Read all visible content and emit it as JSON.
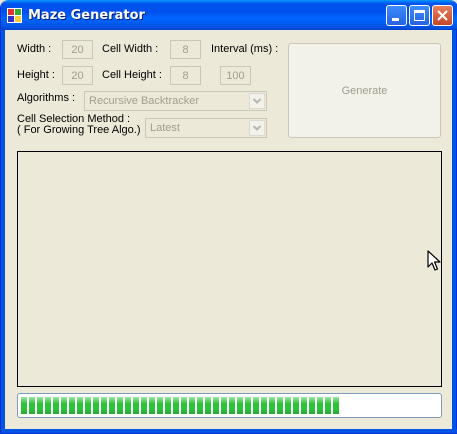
{
  "window": {
    "title": "Maze Generator"
  },
  "form": {
    "width_label": "Width :",
    "width_value": "20",
    "cell_width_label": "Cell Width :",
    "cell_width_value": "8",
    "interval_label": "Interval (ms) :",
    "height_label": "Height :",
    "height_value": "20",
    "cell_height_label": "Cell Height :",
    "cell_height_value": "8",
    "interval_value": "100",
    "algorithms_label": "Algorithms :",
    "algorithm_selected": "Recursive Backtracker",
    "cell_selection_label_1": "Cell Selection Method :",
    "cell_selection_label_2": "( For Growing Tree Algo.)",
    "cell_selection_selected": "Latest",
    "generate_label": "Generate"
  },
  "progress": {
    "fraction": 0.75
  },
  "colors": {
    "titlebar": "#0055e5",
    "window_bg": "#ece9d8",
    "progress_green": "#2ec13a",
    "disabled_text": "#a19e90"
  },
  "icons": {
    "app": "maze-app-icon",
    "minimize": "minimize-icon",
    "maximize": "maximize-icon",
    "close": "close-icon",
    "cursor": "mouse-pointer-icon"
  }
}
